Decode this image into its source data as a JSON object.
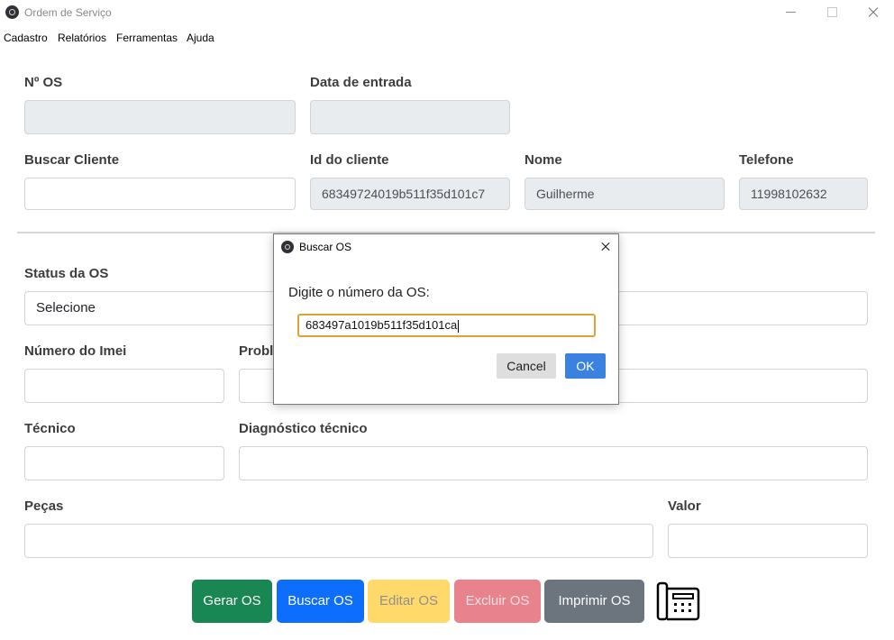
{
  "window": {
    "title": "Ordem de Serviço"
  },
  "menu": {
    "items": [
      "Cadastro",
      "Relatórios",
      "Ferramentas",
      "Ajuda"
    ]
  },
  "form": {
    "os_number": {
      "label": "Nº OS",
      "value": ""
    },
    "entry_date": {
      "label": "Data de entrada",
      "value": ""
    },
    "search_client": {
      "label": "Buscar Cliente",
      "value": ""
    },
    "client_id": {
      "label": "Id do cliente",
      "value": "68349724019b511f35d101c7"
    },
    "name": {
      "label": "Nome",
      "value": "Guilherme"
    },
    "phone": {
      "label": "Telefone",
      "value": "11998102632"
    },
    "status": {
      "label": "Status da OS",
      "value": "Selecione"
    },
    "imei": {
      "label": "Número do Imei",
      "value": ""
    },
    "problem": {
      "label": "Probl",
      "value": ""
    },
    "technician": {
      "label": "Técnico",
      "value": ""
    },
    "diagnosis": {
      "label": "Diagnóstico técnico",
      "value": ""
    },
    "parts": {
      "label": "Peças",
      "value": ""
    },
    "value": {
      "label": "Valor",
      "value": ""
    }
  },
  "actions": {
    "generate": "Gerar OS",
    "search": "Buscar OS",
    "edit": "Editar OS",
    "delete": "Excluir OS",
    "print": "Imprimir OS",
    "icon": "printer-phone-icon"
  },
  "dialog": {
    "title": "Buscar OS",
    "prompt": "Digite o número da OS:",
    "input_value": "683497a1019b511f35d101ca",
    "cancel": "Cancel",
    "ok": "OK"
  },
  "colors": {
    "generate": "#198754",
    "search": "#0d6efd",
    "edit": "#ffda6a",
    "delete": "#e8828d",
    "print": "#6c757d",
    "dialog_ok": "#3b82e0",
    "focus_border": "#e1a232"
  }
}
